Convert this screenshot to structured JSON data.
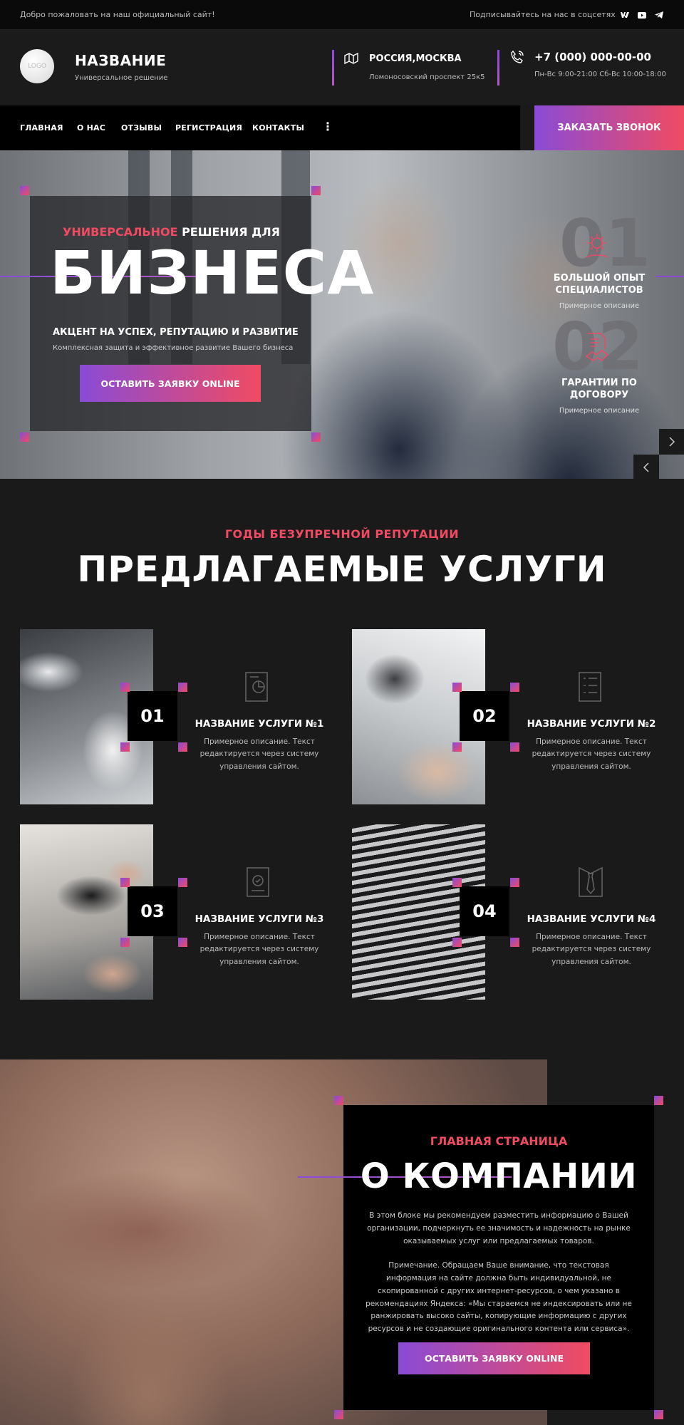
{
  "topbar": {
    "welcome": "Добро пожаловать на наш официальный сайт!",
    "subscribe": "Подписывайтесь на нас в соцсетях",
    "social": [
      "vk-icon",
      "youtube-icon",
      "telegram-icon"
    ]
  },
  "header": {
    "logo": "LOGO",
    "name": "НАЗВАНИЕ",
    "tagline": "Универсальное решение",
    "address_title": "РОССИЯ,МОСКВА",
    "address": "Ломоносовский проспект 25к5",
    "phone": "+7 (000) 000-00-00",
    "hours": "Пн-Вс 9:00-21:00 Сб-Вс 10:00-18:00"
  },
  "nav": {
    "items": [
      "ГЛАВНАЯ",
      "О НАС",
      "ОТЗЫВЫ",
      "РЕГИСТРАЦИЯ",
      "КОНТАКТЫ"
    ],
    "more": "⋮",
    "call_button": "ЗАКАЗАТЬ ЗВОНОК"
  },
  "hero": {
    "subtitle_accent": "УНИВЕРСАЛЬНОЕ",
    "subtitle_rest": " РЕШЕНИЯ ДЛЯ",
    "big": "БИЗНЕСА",
    "headline": "АКЦЕНТ НА УСПЕХ, РЕПУТАЦИЮ И РАЗВИТИЕ",
    "description": "Комплексная защита и эффективное развитие Вашего бизнеса",
    "button": "ОСТАВИТЬ ЗАЯВКУ ONLINE",
    "features": [
      {
        "num": "01",
        "title": "БОЛЬШОЙ ОПЫТ СПЕЦИАЛИСТОВ",
        "desc": "Примерное описание"
      },
      {
        "num": "02",
        "title": "ГАРАНТИИ ПО ДОГОВОРУ",
        "desc": "Примерное описание"
      }
    ]
  },
  "services": {
    "kicker": "ГОДЫ БЕЗУПРЕЧНОЙ РЕПУТАЦИИ",
    "title": "ПРЕДЛАГАЕМЫЕ УСЛУГИ",
    "items": [
      {
        "num": "01",
        "name": "НАЗВАНИЕ УСЛУГИ №1",
        "desc": "Примерное описание. Текст редактируется через систему управления сайтом."
      },
      {
        "num": "02",
        "name": "НАЗВАНИЕ УСЛУГИ №2",
        "desc": "Примерное описание. Текст редактируется через систему управления сайтом."
      },
      {
        "num": "03",
        "name": "НАЗВАНИЕ УСЛУГИ №3",
        "desc": "Примерное описание. Текст редактируется через систему управления сайтом."
      },
      {
        "num": "04",
        "name": "НАЗВАНИЕ УСЛУГИ №4",
        "desc": "Примерное описание. Текст редактируется через систему управления сайтом."
      }
    ]
  },
  "about": {
    "kicker": "ГЛАВНАЯ СТРАНИЦА",
    "title": "О КОМПАНИИ",
    "p1": "В этом блоке мы рекомендуем разместить информацию о Вашей организации, подчеркнуть ее значимость и надежность на рынке оказываемых услуг или предлагаемых товаров.",
    "p2": "Примечание. Обращаем Ваше внимание, что текстовая информация на сайте должна быть индивидуальной, не скопированной с других интернет-ресурсов, о чем указано в рекомендациях Яндекса: «Мы стараемся не индексировать или не ранжировать высоко сайты, копирующие информацию с других ресурсов и не создающие оригинального контента или сервиса».",
    "button": "ОСТАВИТЬ ЗАЯВКУ ONLINE"
  },
  "colors": {
    "accent_purple": "#8a4bd6",
    "accent_red": "#f04b62",
    "background": "#1a1a1b"
  }
}
